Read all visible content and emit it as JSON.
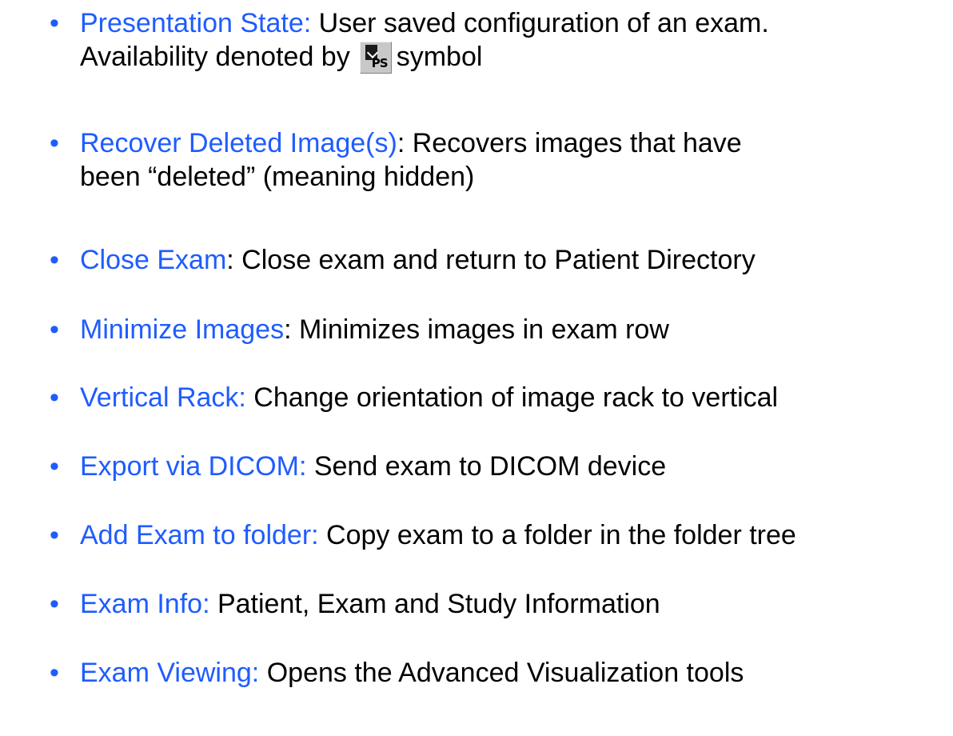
{
  "bullet_glyph": "•",
  "colors": {
    "term": "#1f5cff",
    "body_text": "#000000",
    "background": "#ffffff"
  },
  "items": [
    {
      "term": "Presentation State:",
      "description_line1": " User saved configuration of an exam.",
      "description_line2_before_icon": "Availability denoted by",
      "icon": "presentation-state-icon",
      "icon_label": "PS",
      "description_line2_after_icon": "symbol"
    },
    {
      "term": "Recover Deleted Image(s)",
      "description_line1": ": Recovers images that have",
      "description_line2": "been “deleted” (meaning hidden)"
    },
    {
      "term": "Close Exam",
      "description": ": Close exam and return to Patient Directory"
    },
    {
      "term": "Minimize Images",
      "description": ": Minimizes images in exam row"
    },
    {
      "term": "Vertical Rack:",
      "description": " Change orientation of image rack to vertical"
    },
    {
      "term": "Export via DICOM:",
      "description": " Send exam to DICOM device"
    },
    {
      "term": "Add Exam to folder:",
      "description": " Copy exam to a folder in the folder tree"
    },
    {
      "term": "Exam Info:",
      "description": " Patient, Exam and Study Information"
    },
    {
      "term": "Exam Viewing:",
      "description": " Opens the Advanced Visualization tools"
    }
  ]
}
